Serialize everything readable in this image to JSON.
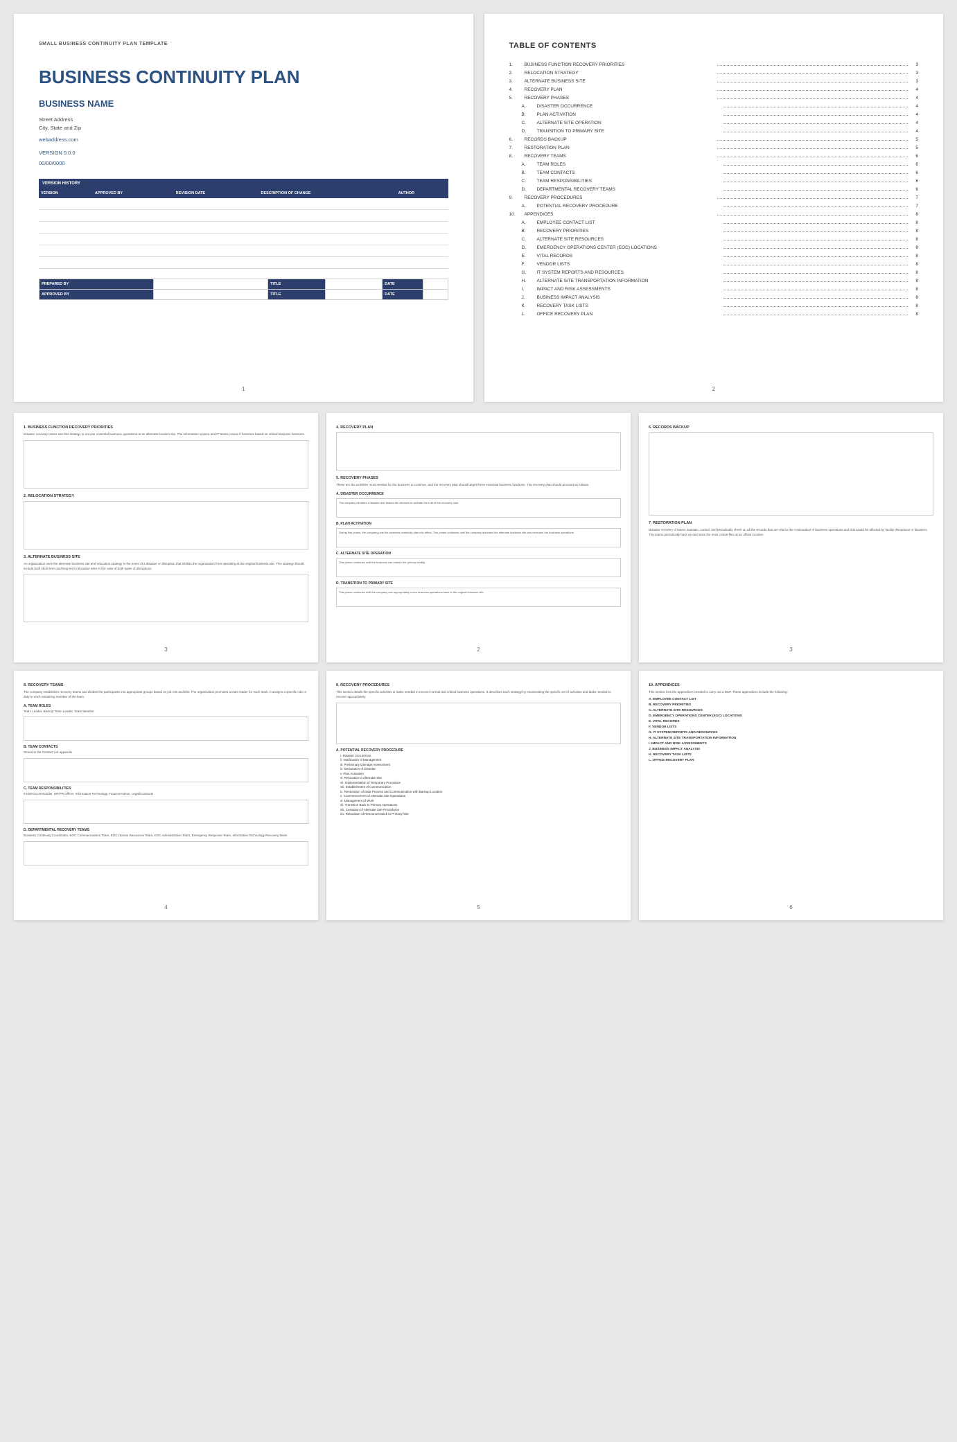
{
  "page1": {
    "small_title": "SMALL BUSINESS CONTINUITY PLAN TEMPLATE",
    "main_title": "BUSINESS CONTINUITY PLAN",
    "business_name": "BUSINESS NAME",
    "street_address": "Street Address",
    "city_state_zip": "City, State and Zip",
    "website": "webaddress.com",
    "version": "VERSION 0.0.0",
    "date": "00/00/0000",
    "version_history_label": "VERSION HISTORY",
    "table_headers": [
      "VERSION",
      "APPROVED BY",
      "REVISION DATE",
      "DESCRIPTION OF CHANGE",
      "AUTHOR"
    ],
    "empty_rows": 6,
    "prepared_by_label": "PREPARED BY",
    "title_label": "TITLE",
    "date_label": "DATE",
    "approved_by_label": "APPROVED BY",
    "page_number": "1"
  },
  "page2": {
    "title": "TABLE OF CONTENTS",
    "items": [
      {
        "num": "1.",
        "label": "BUSINESS FUNCTION RECOVERY PRIORITIES",
        "page": "3"
      },
      {
        "num": "2.",
        "label": "RELOCATION STRATEGY",
        "page": "3"
      },
      {
        "num": "3.",
        "label": "ALTERNATE BUSINESS SITE",
        "page": "3"
      },
      {
        "num": "4.",
        "label": "RECOVERY PLAN",
        "page": "4"
      },
      {
        "num": "5.",
        "label": "RECOVERY PHASES",
        "page": "4"
      },
      {
        "num": "A.",
        "label": "DISASTER OCCURRENCE",
        "page": "4",
        "sub": true
      },
      {
        "num": "B.",
        "label": "PLAN ACTIVATION",
        "page": "4",
        "sub": true
      },
      {
        "num": "C.",
        "label": "ALTERNATE SITE OPERATION",
        "page": "4",
        "sub": true
      },
      {
        "num": "D.",
        "label": "TRANSITION TO PRIMARY SITE",
        "page": "4",
        "sub": true
      },
      {
        "num": "6.",
        "label": "RECORDS BACKUP",
        "page": "5"
      },
      {
        "num": "7.",
        "label": "RESTORATION PLAN",
        "page": "5"
      },
      {
        "num": "8.",
        "label": "RECOVERY TEAMS",
        "page": "6"
      },
      {
        "num": "A.",
        "label": "TEAM ROLES",
        "page": "6",
        "sub": true
      },
      {
        "num": "B.",
        "label": "TEAM CONTACTS",
        "page": "6",
        "sub": true
      },
      {
        "num": "C.",
        "label": "TEAM RESPONSIBILITIES",
        "page": "6",
        "sub": true
      },
      {
        "num": "D.",
        "label": "DEPARTMENTAL RECOVERY TEAMS",
        "page": "6",
        "sub": true
      },
      {
        "num": "9.",
        "label": "RECOVERY PROCEDURES",
        "page": "7"
      },
      {
        "num": "A.",
        "label": "POTENTIAL RECOVERY PROCEDURE",
        "page": "7",
        "sub": true
      },
      {
        "num": "10.",
        "label": "APPENDICES",
        "page": "8"
      },
      {
        "num": "A.",
        "label": "EMPLOYEE CONTACT LIST",
        "page": "8",
        "sub": true
      },
      {
        "num": "B.",
        "label": "RECOVERY PRIORITIES",
        "page": "8",
        "sub": true
      },
      {
        "num": "C.",
        "label": "ALTERNATE SITE RESOURCES",
        "page": "8",
        "sub": true
      },
      {
        "num": "D.",
        "label": "EMERGENCY OPERATIONS CENTER (EOC) LOCATIONS",
        "page": "8",
        "sub": true
      },
      {
        "num": "E.",
        "label": "VITAL RECORDS",
        "page": "8",
        "sub": true
      },
      {
        "num": "F.",
        "label": "VENDOR LISTS",
        "page": "8",
        "sub": true
      },
      {
        "num": "G.",
        "label": "IT SYSTEM REPORTS AND RESOURCES",
        "page": "8",
        "sub": true
      },
      {
        "num": "H.",
        "label": "ALTERNATE SITE TRANSPORTATION INFORMATION",
        "page": "8",
        "sub": true
      },
      {
        "num": "I.",
        "label": "IMPACT AND RISK ASSESSMENTS",
        "page": "8",
        "sub": true
      },
      {
        "num": "J.",
        "label": "BUSINESS IMPACT ANALYSIS",
        "page": "8",
        "sub": true
      },
      {
        "num": "K.",
        "label": "RECOVERY TASK LISTS",
        "page": "8",
        "sub": true
      },
      {
        "num": "L.",
        "label": "OFFICE RECOVERY PLAN",
        "page": "8",
        "sub": true
      }
    ],
    "page_number": "2"
  },
  "page3": {
    "section1": {
      "heading": "1.  BUSINESS FUNCTION RECOVERY PRIORITIES",
      "body": "Disaster recovery teams use this strategy to recover essential business operations at an alternate location site. The information system and IT teams review if functions based on critical business functions."
    },
    "section2": {
      "heading": "2.  RELOCATION STRATEGY"
    },
    "section3": {
      "heading": "3.  ALTERNATE BUSINESS SITE",
      "body": "An organization uses the alternate business site and relocation strategy in the event of a disaster or disruption that inhibits the organization from operating at the original business site. This strategy should include both short-term and long-term relocation sites in the case of both types of disruptions."
    },
    "page_number": "3"
  },
  "page4": {
    "section4": {
      "heading": "4.  RECOVERY PLAN"
    },
    "section5": {
      "heading": "5.  RECOVERY PHASES",
      "body": "These are the activities most needed for the business to continue, and the recovery plan should target these essential business functions. The recovery plan should proceed as follows."
    },
    "subA": {
      "heading": "A.  DISASTER OCCURRENCE",
      "text": "The company declares a disaster and makes the decision to activate the rest of the recovery plan."
    },
    "subB": {
      "heading": "B.  PLAN ACTIVATION",
      "text": "During this phase, the company puts the business continuity plan into effect. This phase continues until the company activates the alternate business site and executes the business operations."
    },
    "subC": {
      "heading": "C.  ALTERNATE SITE OPERATION",
      "text": "This phase continues until the business can restore the primary facility."
    },
    "subD": {
      "heading": "D.  TRANSITION TO PRIMARY SITE",
      "text": "This phase continues until the company can appropriately move business operations back to the original business site."
    },
    "page_number": "2"
  },
  "page5": {
    "section6": {
      "heading": "6.  RECORDS BACKUP"
    },
    "section7": {
      "heading": "7.  RESTORATION PLAN",
      "body": "Disaster recovery of teams maintain, control, and periodically check on all the records that are vital to the continuation of business operations and that would be affected by facility disruptions or disasters. The teams periodically back up and store the most critical files at an offsite location."
    },
    "page_number": "3"
  },
  "page6": {
    "section8": {
      "heading": "8.  RECOVERY TEAMS",
      "body": "The company establishes recovery teams and divides the participants into appropriate groups based on job role and title. The organization promotes a team leader for each team. It assigns a specific role or duty to each remaining member of the team."
    },
    "subA": {
      "heading": "A.  TEAM ROLES",
      "text": "Team Leader, Backup Team Leader, Team Member"
    },
    "subB": {
      "heading": "B.  TEAM CONTACTS",
      "text": "Stored in the Contact List appendix"
    },
    "subC": {
      "heading": "C.  TEAM RESPONSIBILITIES",
      "text": "Incident Commander, HR/PR Officer, Information Technology, Finance/Admin, Legal/Contracts"
    },
    "subD": {
      "heading": "D.  DEPARTMENTAL RECOVERY TEAMS",
      "text": "Business Continuity Coordinator, EOC Communications Team, EOC Human Resources Team, EOC Administration Team, Emergency Response Team, Information Technology Recovery Team"
    },
    "page_number": "4"
  },
  "page7": {
    "section9": {
      "heading": "9.  RECOVERY PROCEDURES",
      "body": "This section details the specific activities or tasks needed to recover normal and critical business operations. It describes each strategy by enumerating the specific set of activities and tasks needed to recover appropriately."
    },
    "subA": {
      "heading": "A.  POTENTIAL RECOVERY PROCEDURE",
      "items": [
        "i.    Disaster Occurrence",
        "ii.   Notification of Management",
        "iii.  Preliminary Damage Assessment",
        "iv.  Declaration of Disaster",
        "v.   Plan Activation",
        "vi.  Relocation to Alternate Site",
        "vii. Implementation of Temporary Procedure",
        "viii. Establishment of Communication",
        "ix.  Restoration of Data Process and Communication with Backup Location",
        "x.   Commencement of Alternate Site Operations",
        "xi.  Management of Work",
        "xii. Transition Back to Primary Operations",
        "xiii. Cessation of Alternate Site Procedures",
        "xiv. Relocation of Resources Back to Primary Site"
      ]
    },
    "page_number": "5"
  },
  "page8": {
    "section10": {
      "heading": "10.  APPENDICES",
      "body": "This section lists the appendices needed to carry out a BCP. These appendices include the following:"
    },
    "items": [
      "A.  EMPLOYEE CONTACT LIST",
      "B.  RECOVERY PRIORITIES",
      "C.  ALTERNATE SITE RESOURCES",
      "D.  EMERGENCY OPERATIONS CENTER (EOC) LOCATIONS",
      "E.  VITAL RECORDS",
      "F.  VENDOR LISTS",
      "G.  IT SYSTEM REPORTS AND RESOURCES",
      "H.  ALTERNATE SITE TRANSPORTATION INFORMATION",
      "I.   IMPACT AND RISK ASSESSMENTS",
      "J.  BUSINESS IMPACT ANALYSIS",
      "K.  RECOVERY TASK LISTS",
      "L.  OFFICE RECOVERY PLAN"
    ],
    "page_number": "6"
  }
}
